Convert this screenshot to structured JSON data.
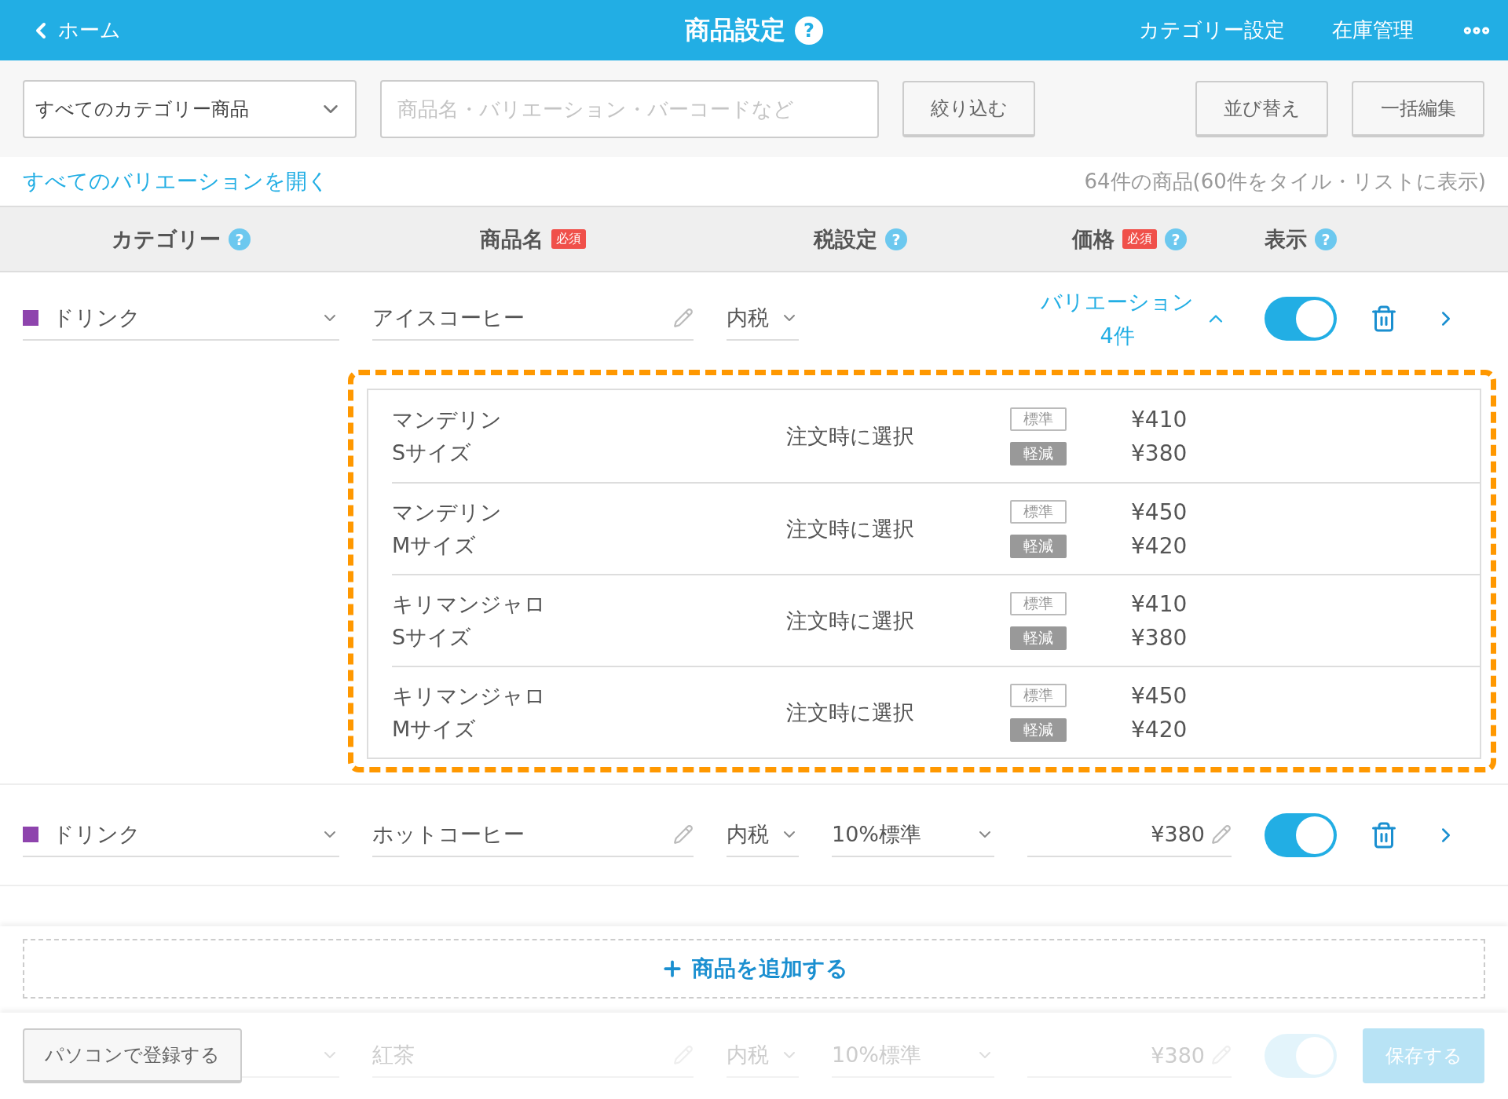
{
  "nav": {
    "back": "ホーム",
    "title": "商品設定",
    "help": "?",
    "links": [
      "カテゴリー設定",
      "在庫管理"
    ]
  },
  "toolbar": {
    "category_select": "すべてのカテゴリー商品",
    "search": {
      "placeholder": "商品名・バリエーション・バーコードなど"
    },
    "filter_button": "絞り込む",
    "buttons": [
      "並び替え",
      "一括編集"
    ]
  },
  "expand_all_link": "すべてのバリエーションを開く",
  "count": "64件の商品(60件をタイル・リストに表示)",
  "columns": [
    {
      "label": "カテゴリー",
      "help": "?"
    },
    {
      "label": "商品名",
      "badge": "必須"
    },
    {
      "label": "税設定",
      "help": "?"
    },
    {
      "label": "価格",
      "badge": "必須",
      "help": "?"
    },
    {
      "label": "表示",
      "help": "?"
    }
  ],
  "products": [
    {
      "category": "ドリンク",
      "color": "#8e44ad",
      "name": "アイスコーヒー",
      "tax": "内税",
      "variation_label": "バリエーション",
      "variation_count": "4件",
      "expanded": true,
      "highlighted": true,
      "visible": true,
      "variations": [
        {
          "name": "マンデリン",
          "size": "Sサイズ",
          "tax_choice": "注文時に選択",
          "prices": [
            {
              "kind": "standard",
              "tag": "標準",
              "price": "¥410"
            },
            {
              "kind": "reduced",
              "tag": "軽減",
              "price": "¥380"
            }
          ]
        },
        {
          "name": "マンデリン",
          "size": "Mサイズ",
          "tax_choice": "注文時に選択",
          "prices": [
            {
              "kind": "standard",
              "tag": "標準",
              "price": "¥450"
            },
            {
              "kind": "reduced",
              "tag": "軽減",
              "price": "¥420"
            }
          ]
        },
        {
          "name": "キリマンジャロ",
          "size": "Sサイズ",
          "tax_choice": "注文時に選択",
          "prices": [
            {
              "kind": "standard",
              "tag": "標準",
              "price": "¥410"
            },
            {
              "kind": "reduced",
              "tag": "軽減",
              "price": "¥380"
            }
          ]
        },
        {
          "name": "キリマンジャロ",
          "size": "Mサイズ",
          "tax_choice": "注文時に選択",
          "prices": [
            {
              "kind": "standard",
              "tag": "標準",
              "price": "¥450"
            },
            {
              "kind": "reduced",
              "tag": "軽減",
              "price": "¥420"
            }
          ]
        }
      ]
    },
    {
      "category": "ドリンク",
      "color": "#8e44ad",
      "name": "ホットコーヒー",
      "tax": "内税",
      "rate": "10%標準",
      "price": "¥380",
      "visible": true
    }
  ],
  "add_button": "商品を追加する",
  "faded_row": {
    "name": "紅茶",
    "tax": "内税",
    "rate": "10%標準",
    "price": "¥380",
    "visible": true
  },
  "footer": {
    "register_button": "パソコンで登録する",
    "save_button": {
      "label": "保存する",
      "disabled": true
    }
  }
}
